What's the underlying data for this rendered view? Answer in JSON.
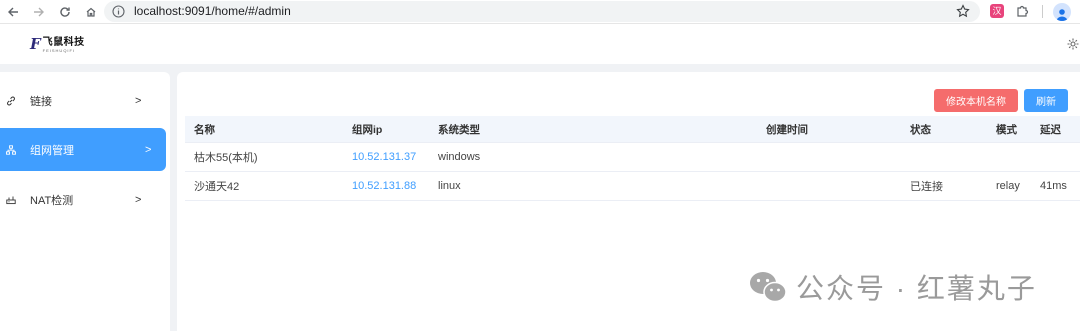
{
  "browser": {
    "url": "localhost:9091/home/#/admin",
    "extension_badge": "汉"
  },
  "app": {
    "logo_mark": "F",
    "logo_text": "飞鼠科技",
    "logo_sub": "FEISHUQIFI"
  },
  "sidebar": {
    "items": [
      {
        "label": "链接",
        "arrow": ">",
        "icon": "link-icon",
        "active": false
      },
      {
        "label": "组网管理",
        "arrow": ">",
        "icon": "network-icon",
        "active": true
      },
      {
        "label": "NAT检测",
        "arrow": ">",
        "icon": "router-icon",
        "active": false
      }
    ]
  },
  "toolbar": {
    "rename_label": "修改本机名称",
    "refresh_label": "刷新"
  },
  "table": {
    "headers": [
      "名称",
      "组网ip",
      "系统类型",
      "创建时间",
      "状态",
      "模式",
      "延迟"
    ],
    "rows": [
      [
        "枯木55(本机)",
        "10.52.131.37",
        "windows",
        "",
        "",
        "",
        ""
      ],
      [
        "沙通天42",
        "10.52.131.88",
        "linux",
        "",
        "已连接",
        "relay",
        "41ms"
      ]
    ]
  },
  "watermark": {
    "text": "公众号 · 红薯丸子"
  },
  "colors": {
    "primary": "#409eff",
    "danger": "#f56c6c",
    "background": "#f0f2f5"
  }
}
